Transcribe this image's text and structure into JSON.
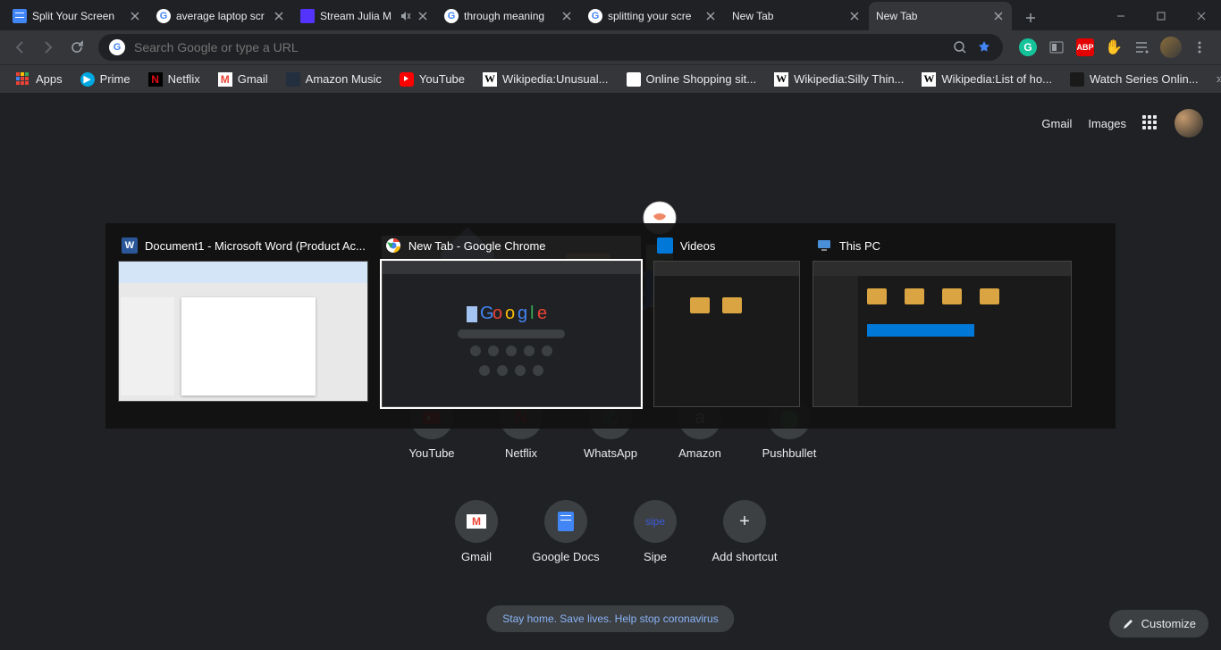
{
  "tabs": [
    {
      "title": "Split Your Screen",
      "favicon": "docs"
    },
    {
      "title": "average laptop scr",
      "favicon": "google"
    },
    {
      "title": "Stream Julia M",
      "favicon": "soundcloud",
      "audio": true
    },
    {
      "title": "through meaning",
      "favicon": "google"
    },
    {
      "title": "splitting your scre",
      "favicon": "google"
    },
    {
      "title": "New Tab",
      "favicon": "none"
    },
    {
      "title": "New Tab",
      "favicon": "none",
      "active": true
    }
  ],
  "omnibox": {
    "placeholder": "Search Google or type a URL"
  },
  "bookmarks": [
    {
      "label": "Apps",
      "icon": "apps"
    },
    {
      "label": "Prime",
      "icon": "prime"
    },
    {
      "label": "Netflix",
      "icon": "netflix"
    },
    {
      "label": "Gmail",
      "icon": "gmail"
    },
    {
      "label": "Amazon Music",
      "icon": "amusic"
    },
    {
      "label": "YouTube",
      "icon": "youtube"
    },
    {
      "label": "Wikipedia:Unusual...",
      "icon": "wiki"
    },
    {
      "label": "Online Shopping sit...",
      "icon": "az"
    },
    {
      "label": "Wikipedia:Silly Thin...",
      "icon": "wiki"
    },
    {
      "label": "Wikipedia:List of ho...",
      "icon": "wiki"
    },
    {
      "label": "Watch Series Onlin...",
      "icon": "ws"
    }
  ],
  "toplinks": {
    "gmail": "Gmail",
    "images": "Images"
  },
  "shortcuts_row1": [
    {
      "label": "YouTube"
    },
    {
      "label": "Netflix"
    },
    {
      "label": "WhatsApp"
    },
    {
      "label": "Amazon"
    },
    {
      "label": "Pushbullet"
    }
  ],
  "shortcuts_row2": [
    {
      "label": "Gmail"
    },
    {
      "label": "Google Docs"
    },
    {
      "label": "Sipe"
    },
    {
      "label": "Add shortcut"
    }
  ],
  "covid": "Stay home. Save lives. Help stop coronavirus",
  "customize": "Customize",
  "alttab": [
    {
      "title": "Document1 - Microsoft Word (Product Ac...",
      "icon": "word"
    },
    {
      "title": "New Tab - Google Chrome",
      "icon": "chrome",
      "selected": true
    },
    {
      "title": "Videos",
      "icon": "explorer"
    },
    {
      "title": "This PC",
      "icon": "thispc"
    }
  ],
  "ext_icons": [
    "search",
    "star",
    "grammarly",
    "reader",
    "abp",
    "gesture"
  ],
  "colors": {
    "accent": "#8ab4f8",
    "bg": "#202124",
    "surface": "#35363a"
  }
}
